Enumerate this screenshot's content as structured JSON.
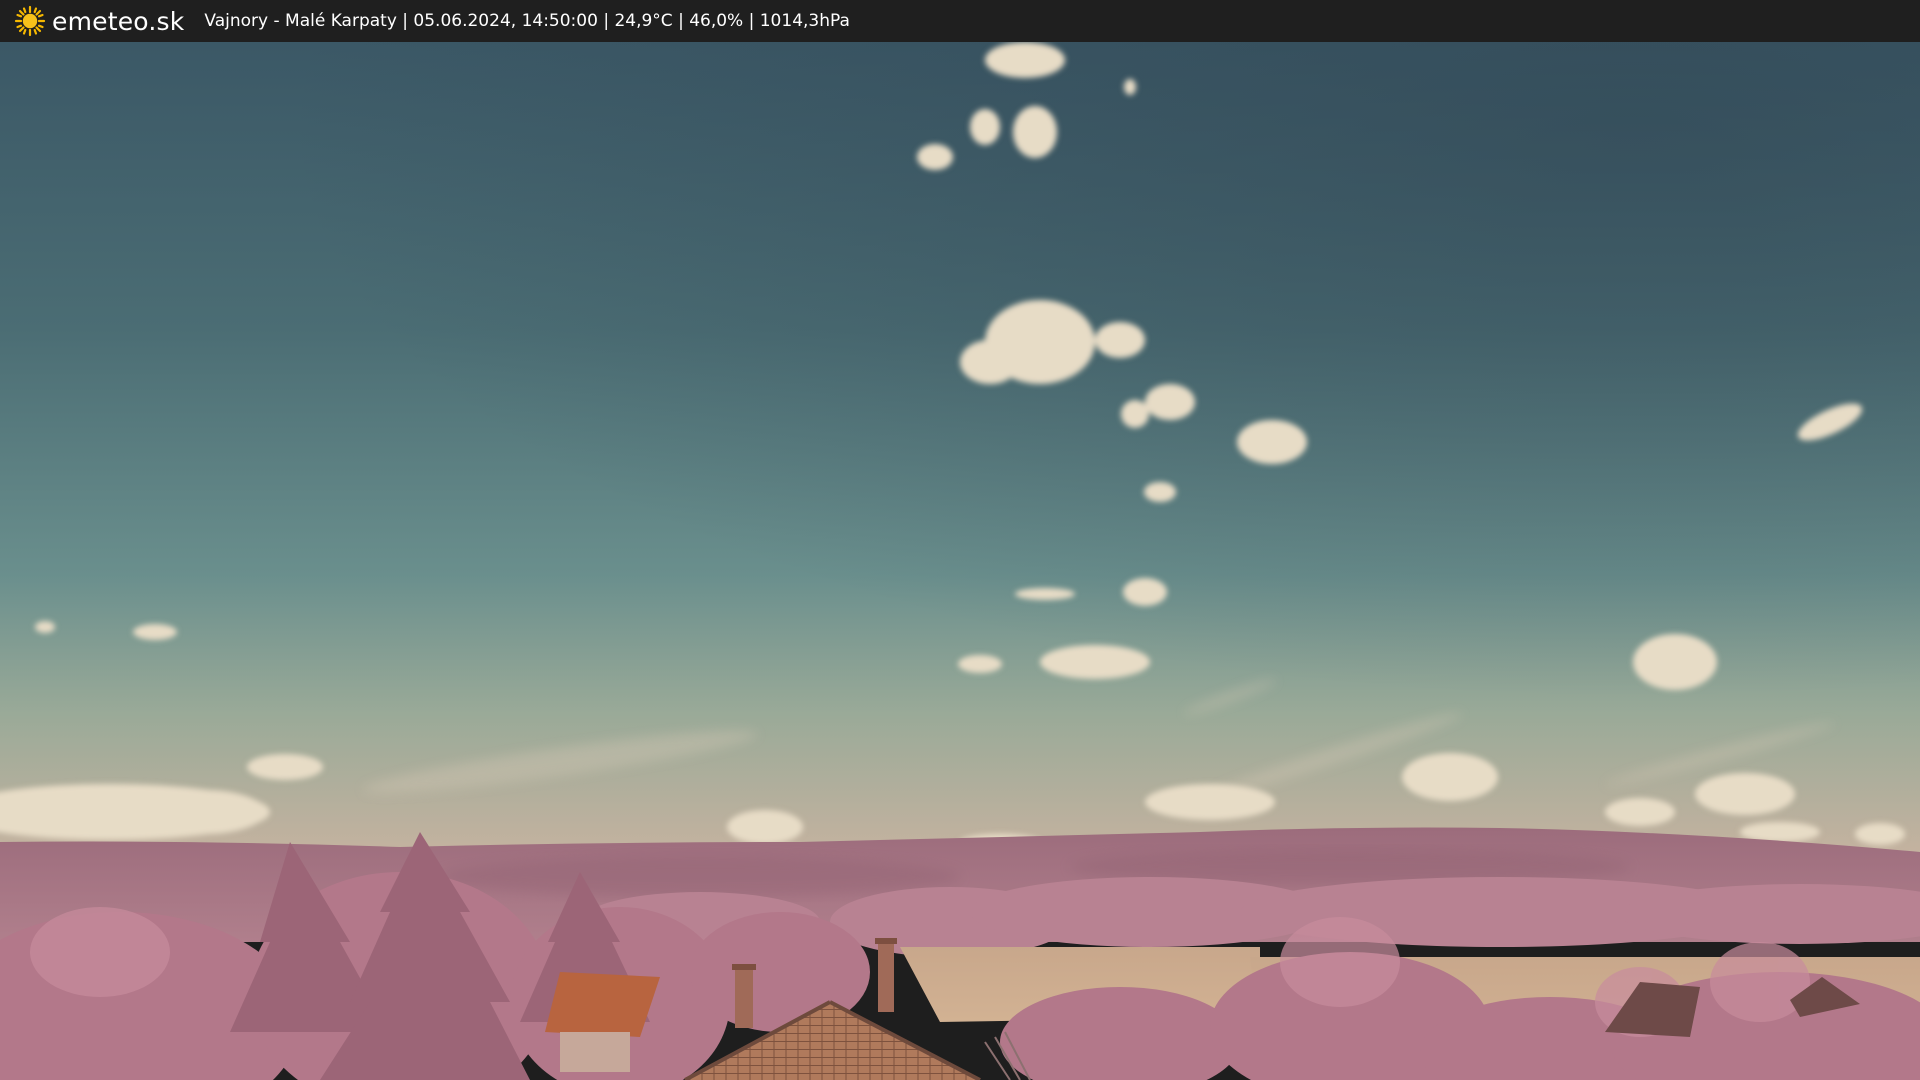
{
  "header": {
    "logo_icon": "sun-icon",
    "site_name": "emeteo.sk",
    "station_info": "Vajnory - Malé Karpaty | 05.06.2024, 14:50:00 | 24,9°C | 46,0% | 1014,3hPa"
  },
  "colors": {
    "bar_background": "#1f1f1f",
    "sun": "#f5b800",
    "sky_top": "#3e5a66",
    "sky_horizon": "#7fa29c",
    "foliage": "#b57a8a",
    "field": "#c9a889",
    "roof": "#b8643f"
  }
}
